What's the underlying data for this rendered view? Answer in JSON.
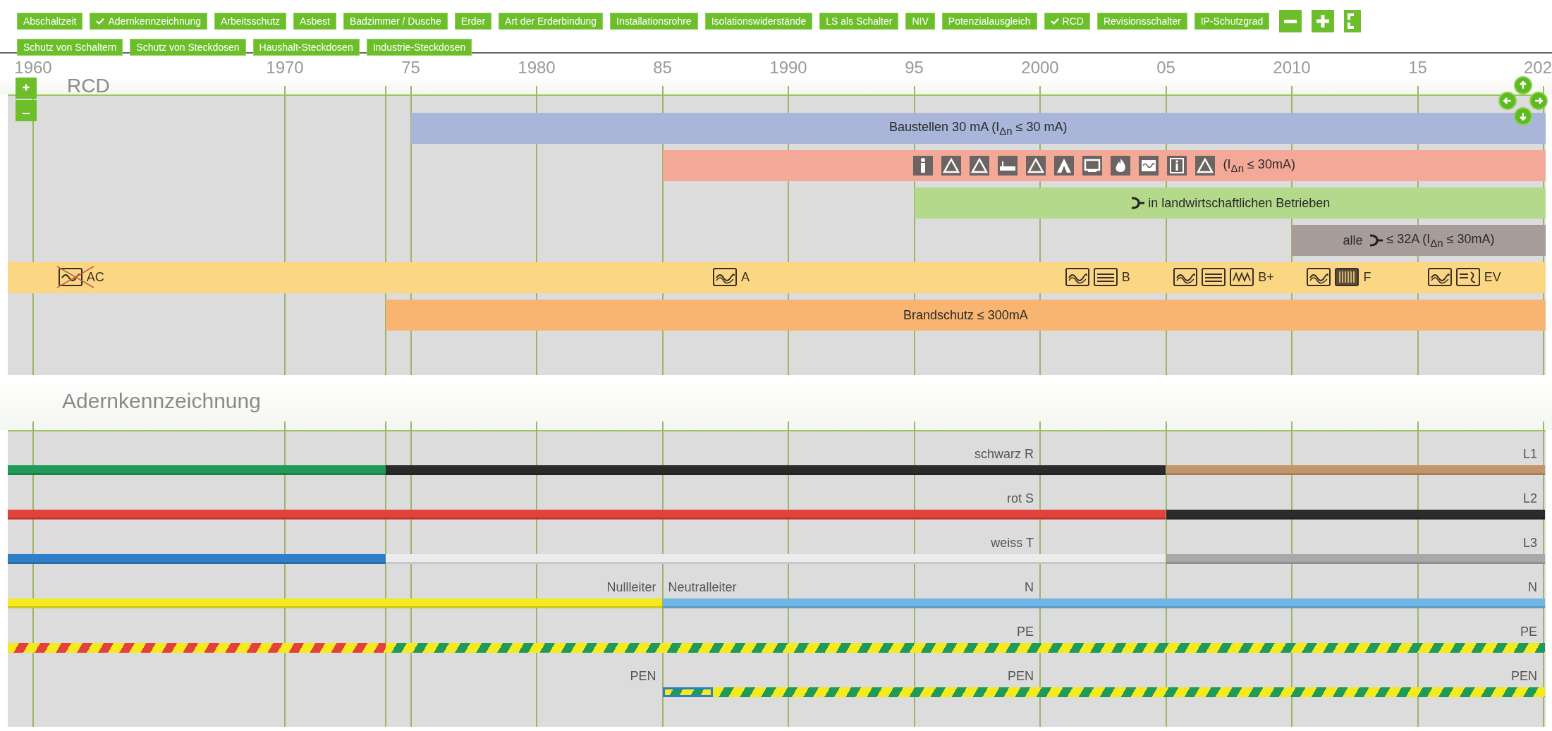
{
  "toolbar": {
    "rows": [
      {
        "buttons": [
          {
            "label": "Abschaltzeit",
            "checked": false
          },
          {
            "label": "Adernkennzeichnung",
            "checked": true
          },
          {
            "label": "Arbeitsschutz",
            "checked": false
          },
          {
            "label": "Asbest",
            "checked": false
          },
          {
            "label": "Badzimmer / Dusche",
            "checked": false
          },
          {
            "label": "Erder",
            "checked": false
          },
          {
            "label": "Art der Erderbindung",
            "checked": false
          },
          {
            "label": "Installationsrohre",
            "checked": false
          },
          {
            "label": "Isolationswiderstände",
            "checked": false
          },
          {
            "label": "LS als Schalter",
            "checked": false
          },
          {
            "label": "NIV",
            "checked": false
          },
          {
            "label": "Potenzialausgleich",
            "checked": false
          },
          {
            "label": "RCD",
            "checked": true
          },
          {
            "label": "Revisionsschalter",
            "checked": false
          },
          {
            "label": "IP-Schutzgrad",
            "checked": false
          }
        ]
      },
      {
        "buttons": [
          {
            "label": "Schutz von Schaltern",
            "checked": false
          },
          {
            "label": "Schutz von Steckdosen",
            "checked": false
          },
          {
            "label": "Haushalt-Steckdosen",
            "checked": false
          },
          {
            "label": "Industrie-Steckdosen",
            "checked": false
          }
        ]
      }
    ]
  },
  "axis": {
    "ticks": [
      "1960",
      "1970",
      "75",
      "1980",
      "85",
      "1990",
      "95",
      "2000",
      "05",
      "2010",
      "15",
      "202"
    ]
  },
  "rcd": {
    "title": "RCD",
    "rows": [
      {
        "kind": "text",
        "color": "#a9b5d9",
        "text": "Baustellen 30 mA (I$_{Δn}$ ≤ 30 mA)"
      },
      {
        "kind": "pictograms",
        "color": "#f4a898",
        "text": "(I$_{Δn}$ ≤ 30mA)"
      },
      {
        "kind": "plug",
        "color": "#b5d98b",
        "text": "in landwirtschaftlichen Betrieben"
      },
      {
        "kind": "plug_prefix",
        "color": "#a69c9a",
        "prefix": "alle",
        "text": "≤ 32A (I$_{Δn}$ ≤ 30mA)"
      },
      {
        "kind": "types",
        "color": "#fcd783",
        "types": [
          "AC",
          "A",
          "B",
          "B+",
          "F",
          "EV"
        ]
      },
      {
        "kind": "text",
        "color": "#f8b571",
        "text": "Brandschutz ≤ 300mA"
      }
    ]
  },
  "cores": {
    "title": "Adernkennzeichnung",
    "wires": [
      {
        "labels": [
          "schwarz R",
          "L1"
        ],
        "segments": [
          {
            "kind": "solid",
            "color": "#1f9a5a"
          },
          {
            "kind": "solid",
            "color": "#2b2b2b"
          },
          {
            "kind": "solid",
            "color": "#c4946a"
          }
        ]
      },
      {
        "labels": [
          "rot S",
          "L2"
        ],
        "segments": [
          {
            "kind": "solid",
            "color": "#e2423a"
          },
          {
            "kind": "solid",
            "color": "#2b2b2b"
          }
        ]
      },
      {
        "labels": [
          "weiss T",
          "L3"
        ],
        "segments": [
          {
            "kind": "solid",
            "color": "#2f7fc8"
          },
          {
            "kind": "solid",
            "color": "#ececec"
          },
          {
            "kind": "solid",
            "color": "#a8a8a8"
          }
        ]
      },
      {
        "labels": [
          "Nullleiter",
          "Neutralleiter",
          "N",
          "N"
        ],
        "segments": [
          {
            "kind": "solid",
            "color": "#f4ea1e"
          },
          {
            "kind": "solid",
            "color": "#6fb5e6"
          }
        ]
      },
      {
        "labels": [
          "PE",
          "PE"
        ],
        "segments": [
          {
            "kind": "striped",
            "color": "#f4ea1e",
            "stripes": {
              "color": "#e2423a"
            }
          },
          {
            "kind": "striped",
            "color": "#f4ea1e",
            "stripes": {
              "color": "#1f9a5a"
            }
          }
        ]
      },
      {
        "labels": [
          "PEN",
          "PEN",
          "PEN"
        ],
        "segments": [
          {
            "kind": "striped_outlined",
            "color": "#f4ea1e",
            "stripes": {
              "color": "#1f9a5a"
            },
            "outline": {
              "color": "#2f7fc8"
            }
          },
          {
            "kind": "striped",
            "color": "#f4ea1e",
            "stripes": {
              "color": "#1f9a5a"
            }
          }
        ]
      }
    ]
  }
}
